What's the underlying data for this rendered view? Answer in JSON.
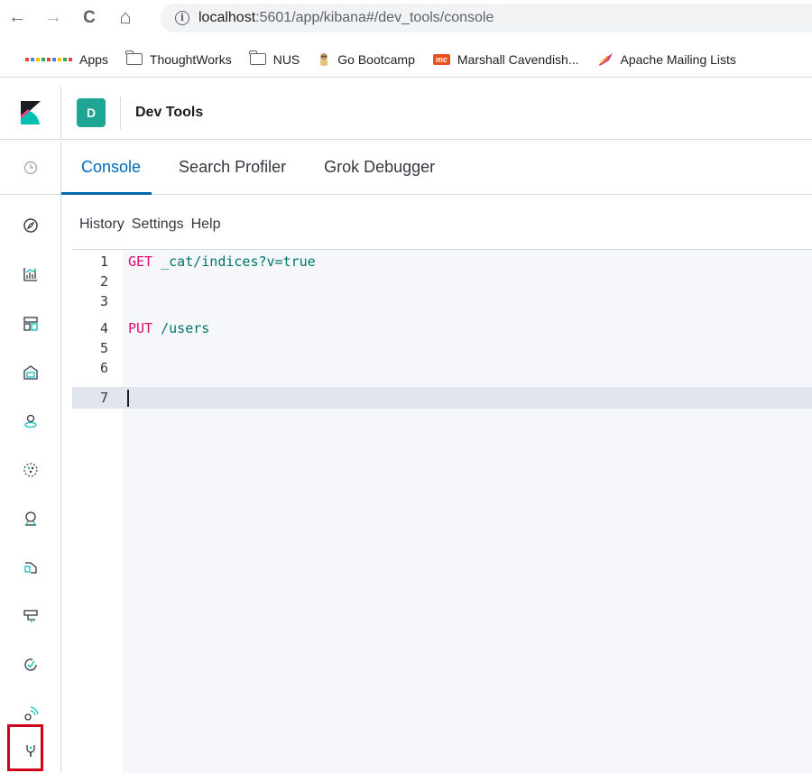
{
  "browser": {
    "back_glyph": "←",
    "forward_glyph": "→",
    "reload_glyph": "C",
    "home_glyph": "⌂",
    "url_host": "localhost",
    "url_path": ":5601/app/kibana#/dev_tools/console",
    "info_glyph": "i"
  },
  "bookmarks": [
    {
      "label": "Apps",
      "icon": "apps-grid-icon"
    },
    {
      "label": "ThoughtWorks",
      "icon": "folder-icon"
    },
    {
      "label": "NUS",
      "icon": "folder-icon"
    },
    {
      "label": "Go Bootcamp",
      "icon": "gopher-icon"
    },
    {
      "label": "Marshall Cavendish...",
      "icon": "mc-logo-icon",
      "badge": "mc"
    },
    {
      "label": "Apache Mailing Lists",
      "icon": "apache-feather-icon"
    }
  ],
  "header": {
    "space_initial": "D",
    "app_title": "Dev Tools"
  },
  "tabs": [
    {
      "label": "Console",
      "active": true
    },
    {
      "label": "Search Profiler",
      "active": false
    },
    {
      "label": "Grok Debugger",
      "active": false
    }
  ],
  "console_menu": {
    "history": "History",
    "settings": "Settings",
    "help": "Help"
  },
  "editor": {
    "line_numbers": [
      "1",
      "2",
      "3",
      "4",
      "5",
      "6",
      "7"
    ],
    "lines": [
      {
        "method": "GET",
        "path": "_cat/indices?v=true"
      },
      {
        "method": "",
        "path": ""
      },
      {
        "method": "",
        "path": ""
      },
      {
        "method": "PUT",
        "path": "/users"
      },
      {
        "method": "",
        "path": ""
      },
      {
        "method": "",
        "path": ""
      },
      {
        "method": "",
        "path": ""
      }
    ],
    "active_line": "7"
  },
  "sidenav": [
    "recent-clock-icon",
    "discover-compass-icon",
    "visualize-icon",
    "dashboard-icon",
    "canvas-icon",
    "maps-icon",
    "ml-icon",
    "infrastructure-icon",
    "logs-icon",
    "apm-icon",
    "uptime-icon",
    "siem-icon",
    "dev-tools-icon"
  ],
  "colors": {
    "accent": "#006bb4",
    "space_badge": "#1ea593",
    "method": "#dd0a73",
    "path": "#00756c",
    "highlight": "#d0021b"
  }
}
